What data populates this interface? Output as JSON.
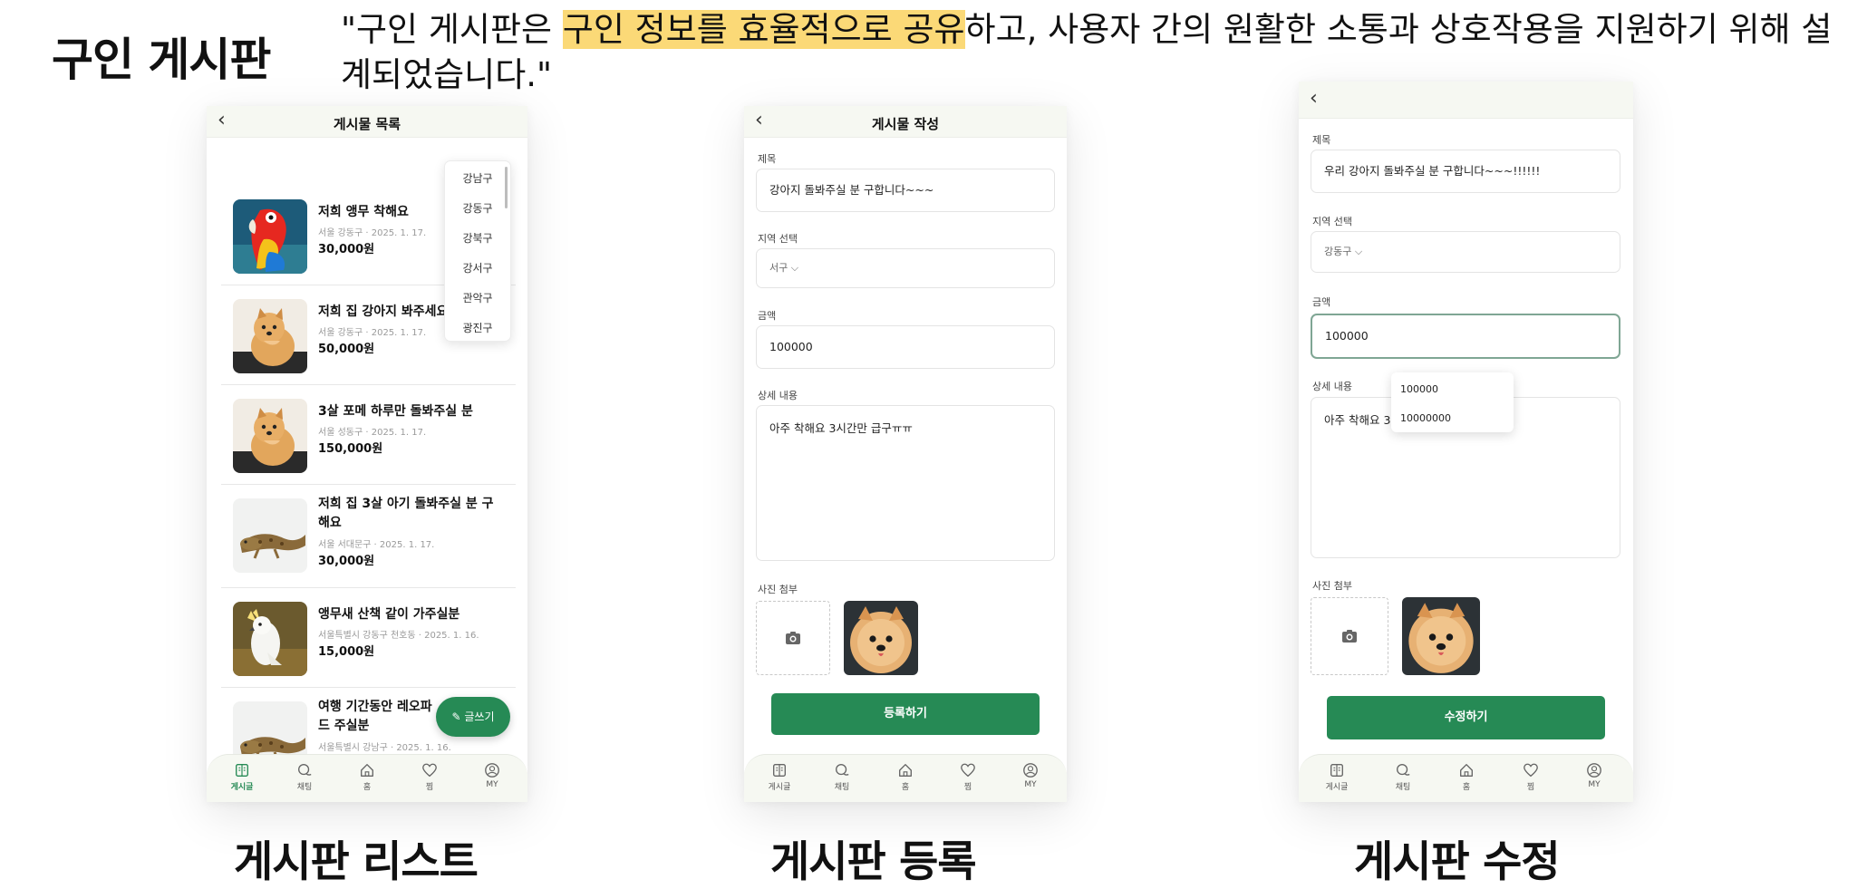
{
  "header": {
    "title": "구인 게시판",
    "quote_before": "\"구인 게시판은 ",
    "quote_highlight": "구인 정보를 효율적으로 공유",
    "quote_after": "하고, 사용자 간의 원활한 소통과 상호작용을 지원하기 위해 설계되었습니다.\""
  },
  "captions": {
    "list": "게시판 리스트",
    "write": "게시판 등록",
    "edit": "게시판 수정"
  },
  "nav": [
    {
      "label": "게시글",
      "icon": "board-icon"
    },
    {
      "label": "채팅",
      "icon": "chat-icon"
    },
    {
      "label": "홈",
      "icon": "home-icon"
    },
    {
      "label": "찜",
      "icon": "heart-icon"
    },
    {
      "label": "MY",
      "icon": "user-icon"
    }
  ],
  "list_screen": {
    "title": "게시물 목록",
    "region_options": [
      "강남구",
      "강동구",
      "강북구",
      "강서구",
      "관악구",
      "광진구"
    ],
    "items": [
      {
        "title": "저희 앵무 착해요",
        "meta": "서울 강동구 · 2025. 1. 17.",
        "price": "30,000원",
        "image": "parrot"
      },
      {
        "title": "저희 집 강아지 봐주세요",
        "meta": "서울 강동구 · 2025. 1. 17.",
        "price": "50,000원",
        "image": "pomeranian"
      },
      {
        "title": "3살 포메 하루만 돌봐주실 분",
        "meta": "서울 성동구 · 2025. 1. 17.",
        "price": "150,000원",
        "image": "pomeranian"
      },
      {
        "title": "저희 집 3살 아기 돌봐주실 분 구해요",
        "meta": "서울 서대문구 · 2025. 1. 17.",
        "price": "30,000원",
        "image": "gecko"
      },
      {
        "title": "앵무새 산책 같이 가주실분",
        "meta": "서울특별시 강동구 천호동 · 2025. 1. 16.",
        "price": "15,000원",
        "image": "cockatoo"
      },
      {
        "title": "여행 기간동안 레오파드 주실분",
        "meta": "서울특별시 강남구 · 2025. 1. 16.",
        "price": "",
        "image": "gecko"
      }
    ],
    "fab_label": "글쓰기"
  },
  "write_screen": {
    "title": "게시물 작성",
    "label_title": "제목",
    "title_value": "강아지 돌봐주실 분 구합니다~~~",
    "label_region": "지역 선택",
    "region_value": "서구",
    "label_price": "금액",
    "price_value": "100000",
    "label_content": "상세 내용",
    "content_value": "아주 착해요 3시간만 급구ㅠㅠ",
    "label_photo": "사진 첨부",
    "submit_label": "등록하기"
  },
  "edit_screen": {
    "label_title": "제목",
    "title_value": "우리 강아지 돌봐주실 분 구합니다~~~!!!!!!",
    "label_region": "지역 선택",
    "region_value": "강동구",
    "label_price": "금액",
    "price_value": "100000",
    "label_content": "상세 내용",
    "content_value": "아주 착해요 3",
    "autocomplete": [
      "100000",
      "10000000"
    ],
    "label_photo": "사진 첨부",
    "submit_label": "수정하기"
  },
  "colors": {
    "accent": "#268a55",
    "highlight": "#fbd977",
    "topbar": "#f6f8f2"
  }
}
